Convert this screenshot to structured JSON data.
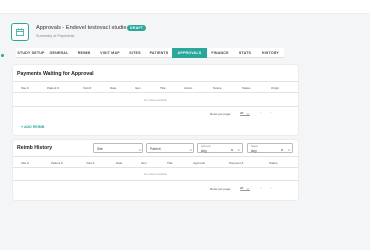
{
  "header": {
    "title": "Approvals - Endevel testovací studie",
    "badge": "DRAFT",
    "subtitle": "Summary of Payments"
  },
  "tabs": [
    {
      "label": "STUDY SETUP",
      "active": false
    },
    {
      "label": "GENERAL",
      "active": false
    },
    {
      "label": "REIMB",
      "active": false
    },
    {
      "label": "VISIT MAP",
      "active": false
    },
    {
      "label": "SITES",
      "active": false
    },
    {
      "label": "PATIENTS",
      "active": false
    },
    {
      "label": "APPROVALS",
      "active": true
    },
    {
      "label": "FINANCE",
      "active": false
    },
    {
      "label": "STATS",
      "active": false
    },
    {
      "label": "HISTORY",
      "active": false
    }
  ],
  "payments_waiting": {
    "title": "Payments Waiting for Approval",
    "columns": [
      "Site #",
      "Patient #",
      "Visit #",
      "Date",
      "Item",
      "Title",
      "Action",
      "Notice",
      "Status",
      "Origin"
    ],
    "empty_text": "No data available",
    "rows_per_page_label": "Rows per page:",
    "rows_per_page_value": "20",
    "add_label": "+ ADD REIMB"
  },
  "reimb_history": {
    "title": "Reimb History",
    "filters": {
      "site_placeholder": "Site",
      "patient_placeholder": "Patient",
      "approval_label": "Approval",
      "approval_value": "Any",
      "status_label": "Status",
      "status_value": "Any"
    },
    "columns": [
      "Site #",
      "Patient #",
      "Visit #",
      "Date",
      "Item",
      "Title",
      "Approval",
      "Payment #",
      "Status"
    ],
    "empty_text": "No data available",
    "rows_per_page_label": "Rows per page:",
    "rows_per_page_value": "20"
  },
  "colors": {
    "accent": "#2aa79b"
  }
}
